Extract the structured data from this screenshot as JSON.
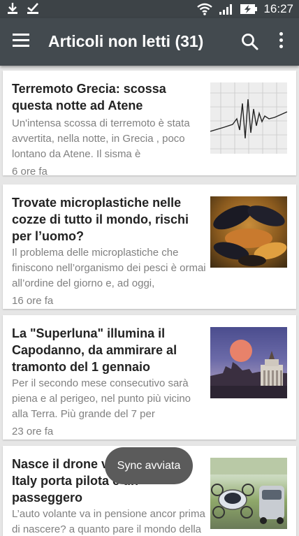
{
  "status_bar": {
    "time": "16:27",
    "icons": [
      "download-icon",
      "check-icon",
      "wifi-icon",
      "signal-icon",
      "battery-charging-icon"
    ]
  },
  "app_bar": {
    "title": "Articoli non letti (31)",
    "icons": [
      "menu-icon",
      "search-icon",
      "more-vert-icon"
    ]
  },
  "articles": [
    {
      "title": "Terremoto Grecia: scossa questa notte ad Atene",
      "excerpt": "Un'intensa scossa di terremoto è stata avvertita, nella notte, in Grecia , poco lontano da Atene.  Il sisma è",
      "time": "6 ore fa",
      "image": "seismograph-image"
    },
    {
      "title": "Trovate microplastiche nelle cozze di tutto il mondo, rischi per l’uomo?",
      "excerpt": "Il problema delle microplastiche che finiscono nell’organismo dei pesci è ormai all’ordine del giorno e, ad oggi,",
      "time": "16 ore fa",
      "image": "mussels-image"
    },
    {
      "title": "La \"Superluna\" illumina il Capodanno, da ammirare al tramonto del 1 gennaio",
      "excerpt": "Per il secondo mese consecutivo sarà piena e al perigeo, nel punto più vicino alla Terra. Più grande del 7 per",
      "time": "23 ore fa",
      "image": "supermoon-image"
    },
    {
      "title": "Nasce il drone volante per gli Italy porta pilota e un passeggero",
      "excerpt": "L’auto volante va in pensione ancor prima di nascere? a quanto pare il mondo della tecnologia sta facendo",
      "time": "",
      "image": "drone-image"
    }
  ],
  "toast": "Sync avviata",
  "colors": {
    "status_bar": "#3d4347",
    "app_bar": "#434a4f",
    "background": "#e6e6e6",
    "card": "#ffffff",
    "title_text": "#222222",
    "secondary_text": "#808080",
    "toast": "#5b5b5b"
  }
}
